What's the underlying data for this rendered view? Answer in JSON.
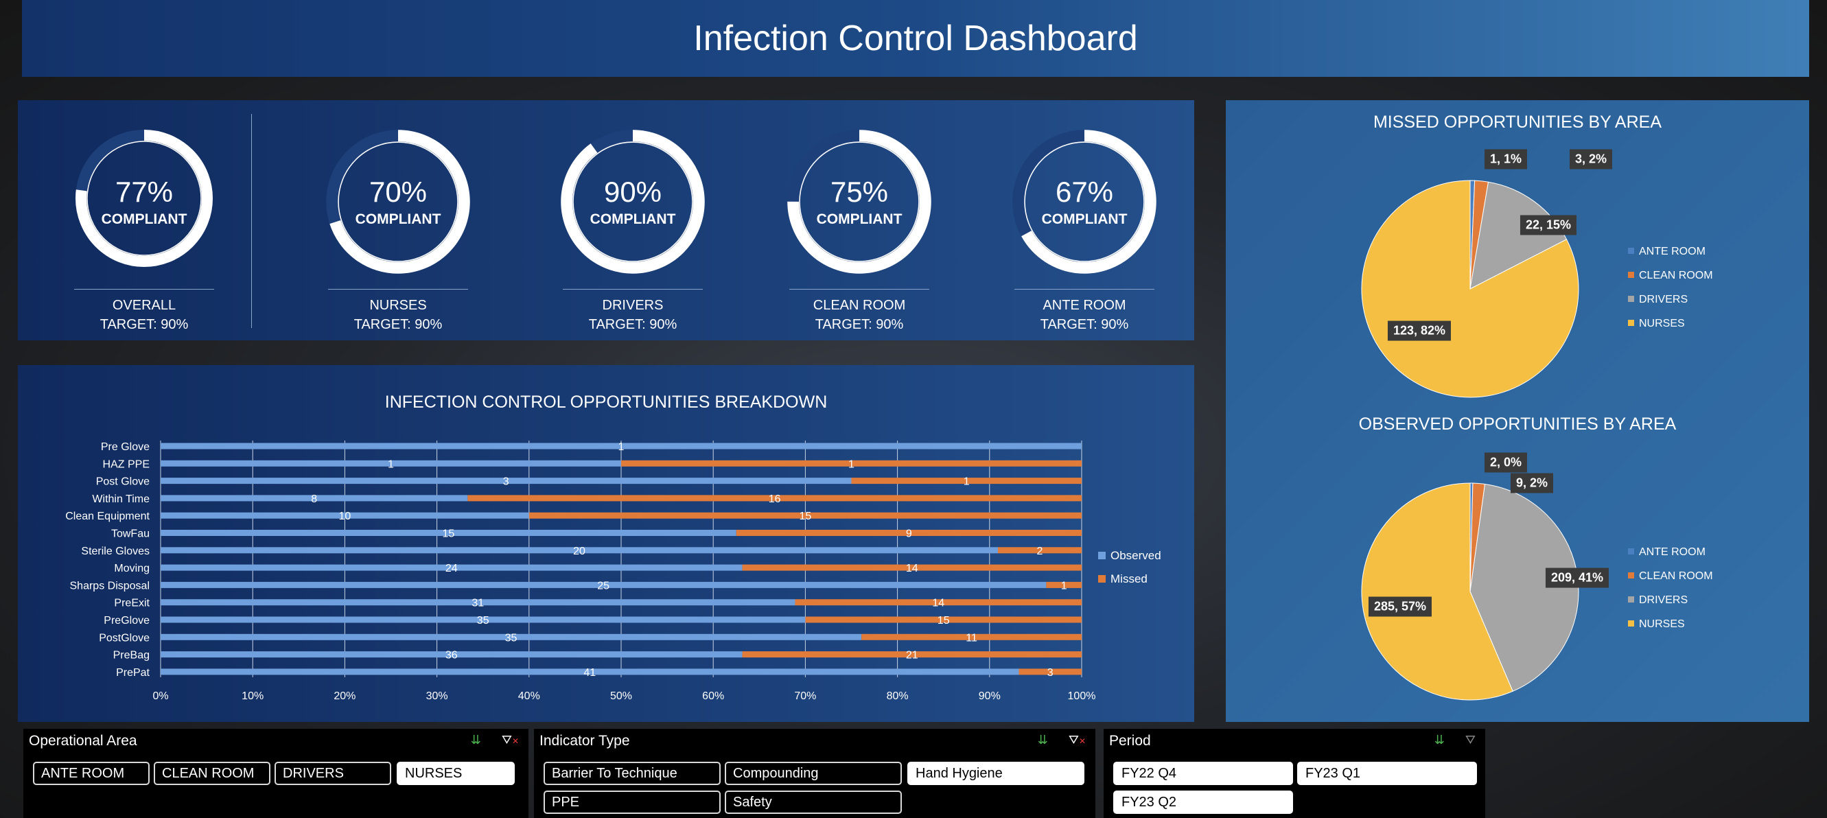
{
  "title": "Infection Control Dashboard",
  "kpis": [
    {
      "value": 0.77,
      "pct": "77%",
      "label": "COMPLIANT",
      "name": "OVERALL",
      "target": "TARGET: 90%"
    },
    {
      "value": 0.7,
      "pct": "70%",
      "label": "COMPLIANT",
      "name": "NURSES",
      "target": "TARGET: 90%"
    },
    {
      "value": 0.9,
      "pct": "90%",
      "label": "COMPLIANT",
      "name": "DRIVERS",
      "target": "TARGET: 90%"
    },
    {
      "value": 0.75,
      "pct": "75%",
      "label": "COMPLIANT",
      "name": "CLEAN ROOM",
      "target": "TARGET: 90%"
    },
    {
      "value": 0.67,
      "pct": "67%",
      "label": "COMPLIANT",
      "name": "ANTE ROOM",
      "target": "TARGET: 90%"
    }
  ],
  "colors": {
    "observed": "#6f9fdc",
    "missed": "#e07b3a",
    "ante": "#4a7fc1",
    "clean": "#e07b3a",
    "drivers": "#a5a5a5",
    "nurses": "#f4bf42"
  },
  "chart_data": [
    {
      "type": "bar",
      "orientation": "horizontal",
      "stacked": "percent",
      "title": "INFECTION CONTROL OPPORTUNITIES BREAKDOWN",
      "categories": [
        "Pre Glove",
        "HAZ PPE",
        "Post Glove",
        "Within Time",
        "Clean Equipment",
        "TowFau",
        "Sterile Gloves",
        "Moving",
        "Sharps Disposal",
        "PreExit",
        "PreGlove",
        "PostGlove",
        "PreBag",
        "PrePat"
      ],
      "series": [
        {
          "name": "Observed",
          "values": [
            1,
            1,
            3,
            8,
            10,
            15,
            20,
            24,
            25,
            31,
            35,
            35,
            36,
            41
          ]
        },
        {
          "name": "Missed",
          "values": [
            0,
            1,
            1,
            16,
            15,
            9,
            2,
            14,
            1,
            14,
            15,
            11,
            21,
            3
          ]
        }
      ],
      "xticks": [
        "0%",
        "10%",
        "20%",
        "30%",
        "40%",
        "50%",
        "60%",
        "70%",
        "80%",
        "90%",
        "100%"
      ],
      "xlim": [
        0,
        1
      ],
      "legend": "right",
      "grid": true
    },
    {
      "type": "pie",
      "title": "MISSED OPPORTUNITIES BY AREA",
      "categories": [
        "ANTE ROOM",
        "CLEAN ROOM",
        "DRIVERS",
        "NURSES"
      ],
      "values": [
        1,
        3,
        22,
        123
      ],
      "labels": [
        "1, 1%",
        "3, 2%",
        "22, 15%",
        "123, 82%"
      ],
      "legend": "right"
    },
    {
      "type": "pie",
      "title": "OBSERVED OPPORTUNITIES BY AREA",
      "categories": [
        "ANTE ROOM",
        "CLEAN ROOM",
        "DRIVERS",
        "NURSES"
      ],
      "values": [
        2,
        9,
        209,
        285
      ],
      "labels": [
        "2, 0%",
        "9, 2%",
        "209, 41%",
        "285, 57%"
      ],
      "legend": "right"
    }
  ],
  "slicers": {
    "operational_area": {
      "title": "Operational Area",
      "items": [
        {
          "label": "ANTE ROOM",
          "selected": false
        },
        {
          "label": "CLEAN ROOM",
          "selected": false
        },
        {
          "label": "DRIVERS",
          "selected": false
        },
        {
          "label": "NURSES",
          "selected": true
        }
      ]
    },
    "indicator_type": {
      "title": "Indicator Type",
      "items": [
        {
          "label": "Barrier To Technique",
          "selected": false
        },
        {
          "label": "Compounding",
          "selected": false
        },
        {
          "label": "Hand Hygiene",
          "selected": true
        },
        {
          "label": "PPE",
          "selected": false
        },
        {
          "label": "Safety",
          "selected": false
        }
      ]
    },
    "period": {
      "title": "Period",
      "items": [
        {
          "label": "FY22 Q4",
          "selected": true
        },
        {
          "label": "FY23 Q1",
          "selected": true
        },
        {
          "label": "FY23 Q2",
          "selected": true
        }
      ]
    }
  }
}
